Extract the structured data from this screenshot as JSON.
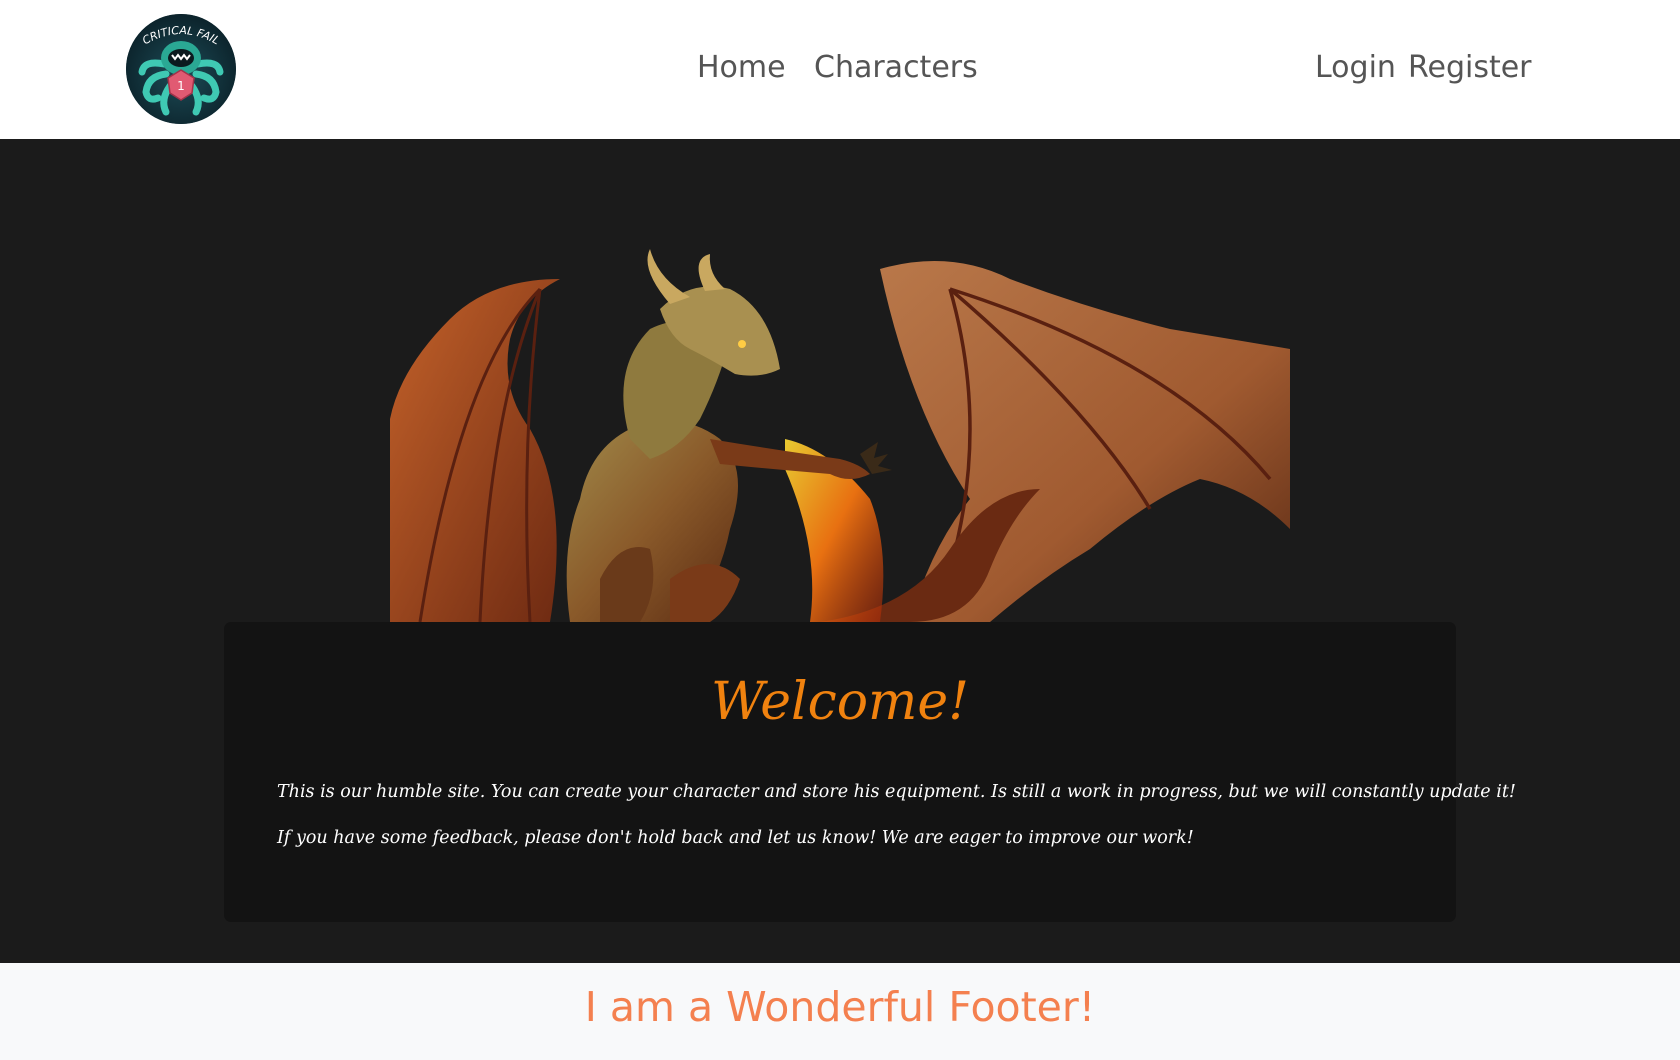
{
  "navbar": {
    "logo_text": "CRITICAL FAIL",
    "links": {
      "home": "Home",
      "characters": "Characters",
      "login": "Login",
      "register": "Register"
    }
  },
  "main": {
    "welcome_title": "Welcome!",
    "paragraphs": [
      "This is our humble site. You can create your character and store his equipment. Is still a work in progress, but we will constantly update it!",
      "If you have some feedback, please don't hold back and let us know! We are eager to improve our work!"
    ]
  },
  "footer": {
    "text": "I am a Wonderful Footer!"
  },
  "colors": {
    "navbar_bg": "#ffffff",
    "main_bg": "#1b1b1b",
    "card_bg": "#131313",
    "accent_orange": "#f0820f",
    "footer_text": "#f4804f",
    "footer_bg": "#f8f9fa"
  }
}
